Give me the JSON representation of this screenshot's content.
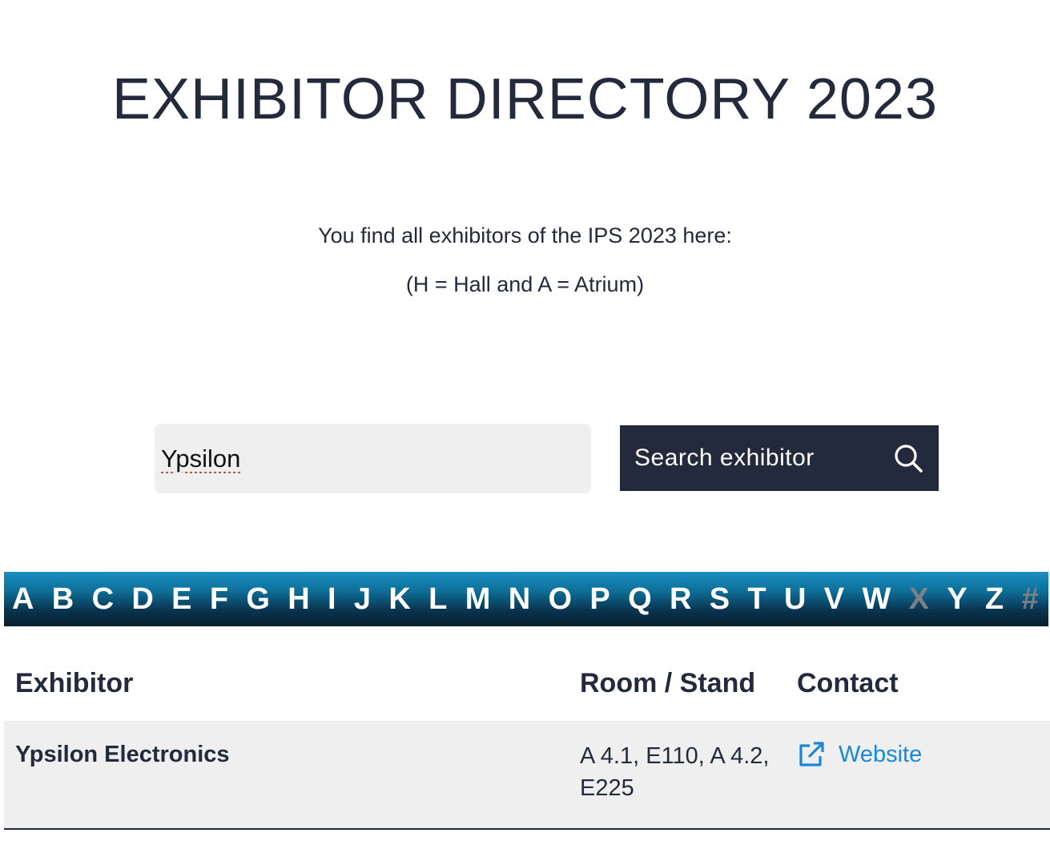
{
  "header": {
    "title": "EXHIBITOR DIRECTORY 2023"
  },
  "intro": {
    "line1": "You find all exhibitors of the IPS 2023 here:",
    "line2": "(H = Hall and A = Atrium)"
  },
  "search": {
    "value": "Ypsilon",
    "button_label": "Search exhibitor",
    "icon": "search-icon"
  },
  "alphabet": {
    "letters": [
      "A",
      "B",
      "C",
      "D",
      "E",
      "F",
      "G",
      "H",
      "I",
      "J",
      "K",
      "L",
      "M",
      "N",
      "O",
      "P",
      "Q",
      "R",
      "S",
      "T",
      "U",
      "V",
      "W",
      "X",
      "Y",
      "Z",
      "#"
    ],
    "disabled": [
      "X",
      "#"
    ]
  },
  "table": {
    "headers": {
      "exhibitor": "Exhibitor",
      "stand": "Room / Stand",
      "contact": "Contact"
    },
    "rows": [
      {
        "exhibitor": "Ypsilon Electronics",
        "stand": "A 4.1, E110, A 4.2, E225",
        "contact_label": "Website",
        "contact_icon": "external-link-icon"
      }
    ]
  },
  "colors": {
    "navy": "#232a3b",
    "link_blue": "#1a87d8",
    "input_bg": "#efefef",
    "bar_top": "#1a8fc2",
    "bar_bottom": "#061e2d"
  }
}
